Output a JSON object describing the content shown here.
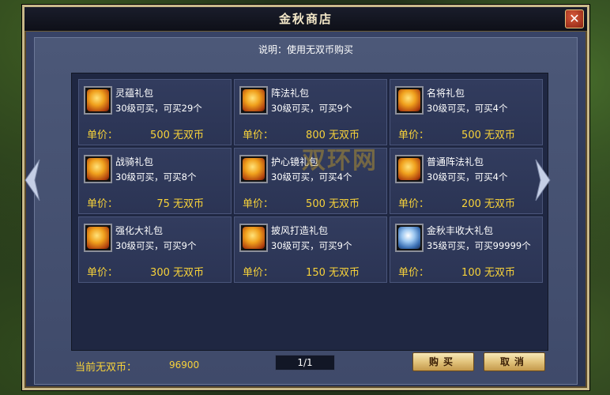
{
  "window": {
    "title": "金秋商店",
    "close_symbol": "✕"
  },
  "description": "说明：使用无双币购买",
  "watermark": "双环网",
  "items": [
    {
      "name": "灵蕴礼包",
      "limit": "30级可买，可买29个",
      "price_label": "单价：",
      "price": "500 无双币",
      "icon": "gift-gold-icon"
    },
    {
      "name": "阵法礼包",
      "limit": "30级可买，可买9个",
      "price_label": "单价：",
      "price": "800 无双币",
      "icon": "gift-gold-icon"
    },
    {
      "name": "名将礼包",
      "limit": "30级可买，可买4个",
      "price_label": "单价：",
      "price": "500 无双币",
      "icon": "gift-gold-icon"
    },
    {
      "name": "战骑礼包",
      "limit": "30级可买，可买8个",
      "price_label": "单价：",
      "price": "75 无双币",
      "icon": "gift-gold-icon"
    },
    {
      "name": "护心镜礼包",
      "limit": "30级可买，可买4个",
      "price_label": "单价：",
      "price": "500 无双币",
      "icon": "gift-gold-icon"
    },
    {
      "name": "普通阵法礼包",
      "limit": "30级可买，可买4个",
      "price_label": "单价：",
      "price": "200 无双币",
      "icon": "gift-gold-icon"
    },
    {
      "name": "强化大礼包",
      "limit": "30级可买，可买9个",
      "price_label": "单价：",
      "price": "300 无双币",
      "icon": "gift-gold-icon"
    },
    {
      "name": "披风打造礼包",
      "limit": "30级可买，可买9个",
      "price_label": "单价：",
      "price": "150 无双币",
      "icon": "gift-gold-icon"
    },
    {
      "name": "金秋丰收大礼包",
      "limit": "35级可买，可买99999个",
      "price_label": "单价：",
      "price": "100 无双币",
      "icon": "gift-blue-icon"
    }
  ],
  "footer": {
    "currency_label": "当前无双币：",
    "currency_value": "96900",
    "page": "1/1",
    "buy_label": "购买",
    "cancel_label": "取消"
  }
}
